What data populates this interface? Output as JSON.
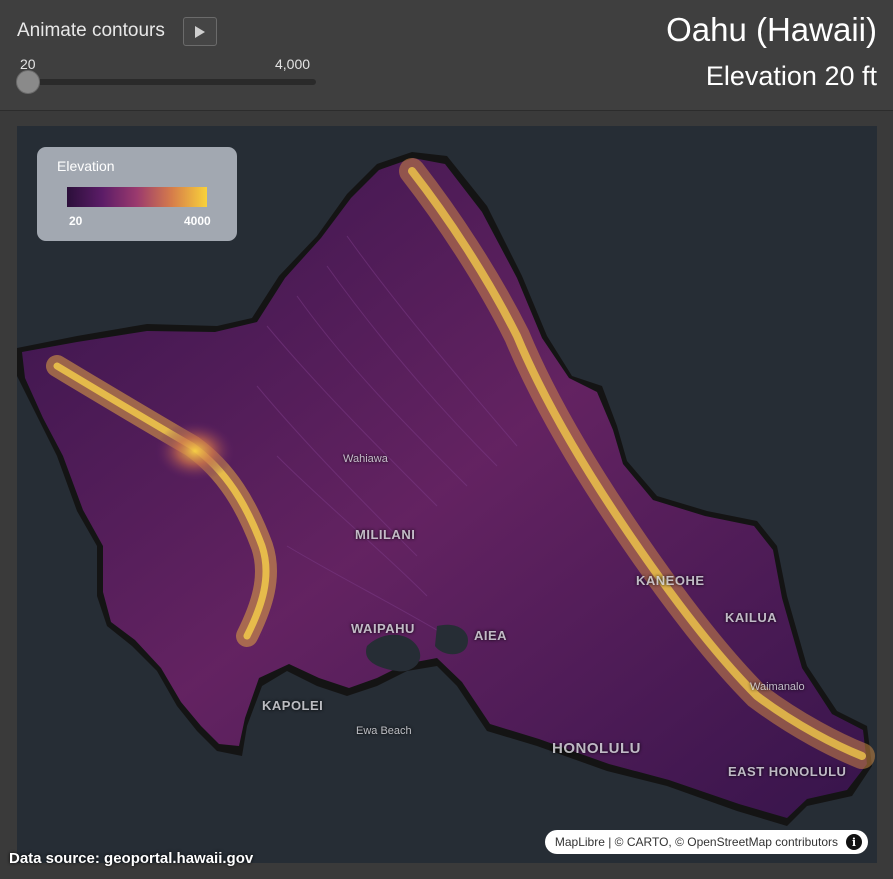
{
  "controls": {
    "animate_label": "Animate contours",
    "play_icon": "play-icon",
    "slider_min_label": "20",
    "slider_max_label": "4,000",
    "slider_value": 20,
    "slider_range": [
      20,
      4000
    ]
  },
  "header": {
    "title": "Oahu (Hawaii)",
    "subtitle": "Elevation 20 ft"
  },
  "legend": {
    "title": "Elevation",
    "min_label": "20",
    "max_label": "4000",
    "ramp_colors": [
      "#2b0f3a",
      "#5b1c67",
      "#9b3a6e",
      "#d67d4a",
      "#f9d23a"
    ]
  },
  "map": {
    "background_color": "#262d35",
    "land_color": "#151515",
    "places": {
      "wahiawa": "Wahiawa",
      "mililani": "MILILANI",
      "waipahu": "WAIPAHU",
      "aiea": "AIEA",
      "kaneohe": "KANEOHE",
      "kailua": "KAILUA",
      "waimanalo": "Waimanalo",
      "kapolei": "KAPOLEI",
      "ewa_beach": "Ewa Beach",
      "honolulu": "HONOLULU",
      "east_honolulu": "EAST HONOLULU"
    }
  },
  "attribution": {
    "text": "MapLibre | © CARTO, © OpenStreetMap contributors",
    "info_icon": "info-icon"
  },
  "footer": {
    "data_source": "Data source: geoportal.hawaii.gov"
  }
}
